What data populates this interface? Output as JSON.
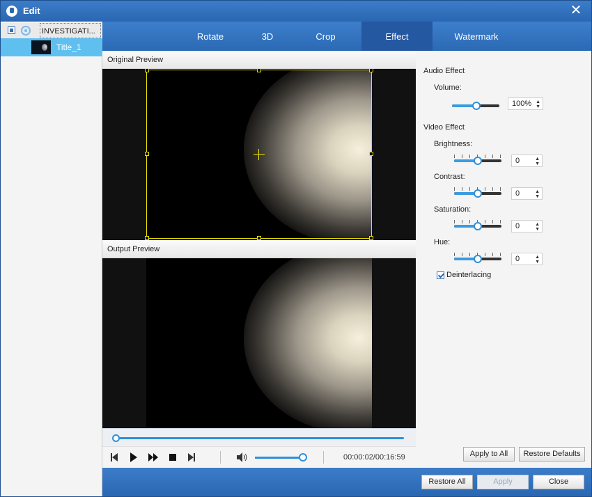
{
  "window": {
    "title": "Edit"
  },
  "source_list": {
    "source_name": "INVESTIGATI...",
    "title_item": "Title_1"
  },
  "tabs": [
    {
      "label": "Rotate",
      "active": false
    },
    {
      "label": "3D",
      "active": false
    },
    {
      "label": "Crop",
      "active": false
    },
    {
      "label": "Effect",
      "active": true
    },
    {
      "label": "Watermark",
      "active": false
    }
  ],
  "preview": {
    "original_label": "Original Preview",
    "output_label": "Output Preview"
  },
  "player": {
    "time": "00:00:02/00:16:59",
    "progress_fraction": 0.0,
    "volume_fraction": 0.98
  },
  "audio_effect": {
    "title": "Audio Effect",
    "volume_label": "Volume:",
    "volume_value": "100%"
  },
  "video_effect": {
    "title": "Video Effect",
    "brightness_label": "Brightness:",
    "brightness_value": "0",
    "contrast_label": "Contrast:",
    "contrast_value": "0",
    "saturation_label": "Saturation:",
    "saturation_value": "0",
    "hue_label": "Hue:",
    "hue_value": "0",
    "deinterlacing_label": "Deinterlacing",
    "deinterlacing_checked": true
  },
  "buttons": {
    "apply_to_all": "Apply to All",
    "restore_defaults": "Restore Defaults",
    "restore_all": "Restore All",
    "apply": "Apply",
    "close": "Close"
  },
  "colors": {
    "accent": "#2a67b3",
    "selected_row": "#5fc0f0",
    "crop_border": "#e8e000"
  }
}
